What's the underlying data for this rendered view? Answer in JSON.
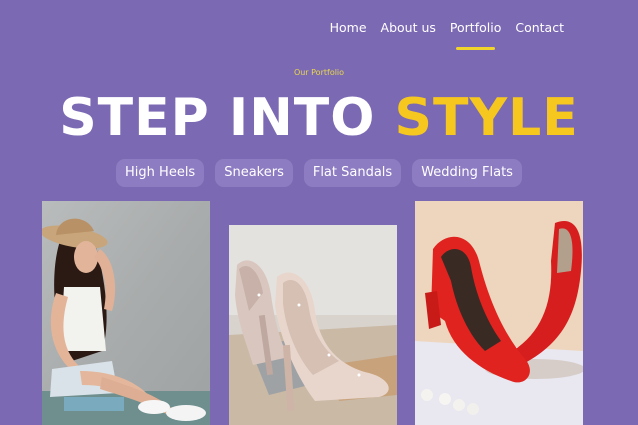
{
  "nav": {
    "items": [
      {
        "label": "Home",
        "active": false
      },
      {
        "label": "About us",
        "active": false
      },
      {
        "label": "Portfolio",
        "active": true
      },
      {
        "label": "Contact",
        "active": false
      }
    ]
  },
  "hero": {
    "eyebrow": "Our Portfolio",
    "title_main": "STEP INTO",
    "title_accent": "STYLE"
  },
  "filters": [
    "High Heels",
    "Sneakers",
    "Flat Sandals",
    "Wedding Flats"
  ],
  "colors": {
    "background": "#7c69b3",
    "accent": "#f6c71e",
    "chip": "#8e7cc3"
  }
}
